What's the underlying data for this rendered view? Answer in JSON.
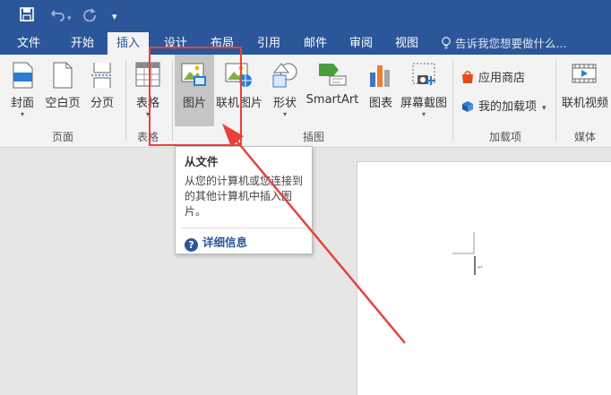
{
  "qat": {
    "save_icon": "save-icon",
    "undo_icon": "undo-icon",
    "redo_icon": "redo-icon",
    "customize_icon": "customize-qat-icon"
  },
  "tabs": [
    {
      "label": "文件"
    },
    {
      "label": "开始"
    },
    {
      "label": "插入"
    },
    {
      "label": "设计"
    },
    {
      "label": "布局"
    },
    {
      "label": "引用"
    },
    {
      "label": "邮件"
    },
    {
      "label": "审阅"
    },
    {
      "label": "视图"
    }
  ],
  "tell_me": {
    "text": "告诉我您想要做什么..."
  },
  "ribbon": {
    "pages": {
      "cover": "封面",
      "blank": "空白页",
      "break": "分页",
      "group": "页面"
    },
    "tables": {
      "table": "表格",
      "group": "表格"
    },
    "illustrations": {
      "pictures": "图片",
      "online_pictures": "联机图片",
      "shapes": "形状",
      "smartart": "SmartArt",
      "chart": "图表",
      "screenshot": "屏幕截图",
      "group": "插图"
    },
    "addins": {
      "store": "应用商店",
      "my_addins": "我的加载项",
      "group": "加载项"
    },
    "media": {
      "online_video": "联机视频",
      "group": "媒体"
    }
  },
  "tooltip": {
    "title": "从文件",
    "description": "从您的计算机或您连接到的其他计算机中插入图片。",
    "help": "详细信息"
  },
  "colors": {
    "brand": "#2b579a",
    "annotation": "#e8413b"
  }
}
